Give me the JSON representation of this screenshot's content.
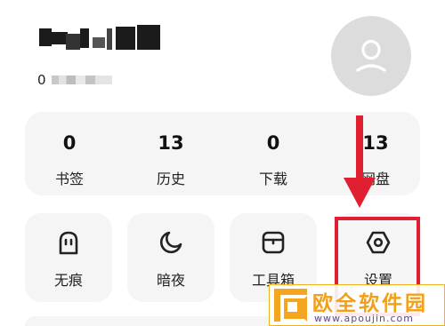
{
  "profile": {
    "id_prefix": "0"
  },
  "stats": [
    {
      "value": "0",
      "label": "书签"
    },
    {
      "value": "13",
      "label": "历史"
    },
    {
      "value": "0",
      "label": "下载"
    },
    {
      "value": "13",
      "label": "网盘"
    }
  ],
  "tools": [
    {
      "label": "无痕",
      "icon": "incognito-ghost-icon"
    },
    {
      "label": "暗夜",
      "icon": "moon-icon"
    },
    {
      "label": "工具箱",
      "icon": "toolbox-icon"
    },
    {
      "label": "设置",
      "icon": "settings-hexagon-icon"
    }
  ],
  "annotation": {
    "color": "#e01f30"
  },
  "watermark": {
    "title": "欧全软件园",
    "url": "www.apoujin.com"
  }
}
